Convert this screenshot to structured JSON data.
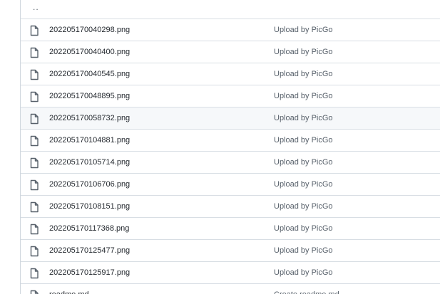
{
  "parent_dir": {
    "label": ".."
  },
  "files": [
    {
      "name": "202205170040298.png",
      "commit": "Upload by PicGo",
      "icon": "file-icon"
    },
    {
      "name": "202205170040400.png",
      "commit": "Upload by PicGo",
      "icon": "file-icon"
    },
    {
      "name": "202205170040545.png",
      "commit": "Upload by PicGo",
      "icon": "file-icon"
    },
    {
      "name": "202205170048895.png",
      "commit": "Upload by PicGo",
      "icon": "file-icon"
    },
    {
      "name": "202205170058732.png",
      "commit": "Upload by PicGo",
      "icon": "file-icon",
      "hovered": true
    },
    {
      "name": "202205170104881.png",
      "commit": "Upload by PicGo",
      "icon": "file-icon"
    },
    {
      "name": "202205170105714.png",
      "commit": "Upload by PicGo",
      "icon": "file-icon"
    },
    {
      "name": "202205170106706.png",
      "commit": "Upload by PicGo",
      "icon": "file-icon"
    },
    {
      "name": "202205170108151.png",
      "commit": "Upload by PicGo",
      "icon": "file-icon"
    },
    {
      "name": "202205170117368.png",
      "commit": "Upload by PicGo",
      "icon": "file-icon"
    },
    {
      "name": "202205170125477.png",
      "commit": "Upload by PicGo",
      "icon": "file-icon"
    },
    {
      "name": "202205170125917.png",
      "commit": "Upload by PicGo",
      "icon": "file-icon"
    },
    {
      "name": "readme.md",
      "commit": "Create readme.md",
      "icon": "file-icon"
    }
  ],
  "colors": {
    "hover_row_bg": "#f6f8fa",
    "border": "#d8dee4",
    "icon": "#57606a"
  }
}
